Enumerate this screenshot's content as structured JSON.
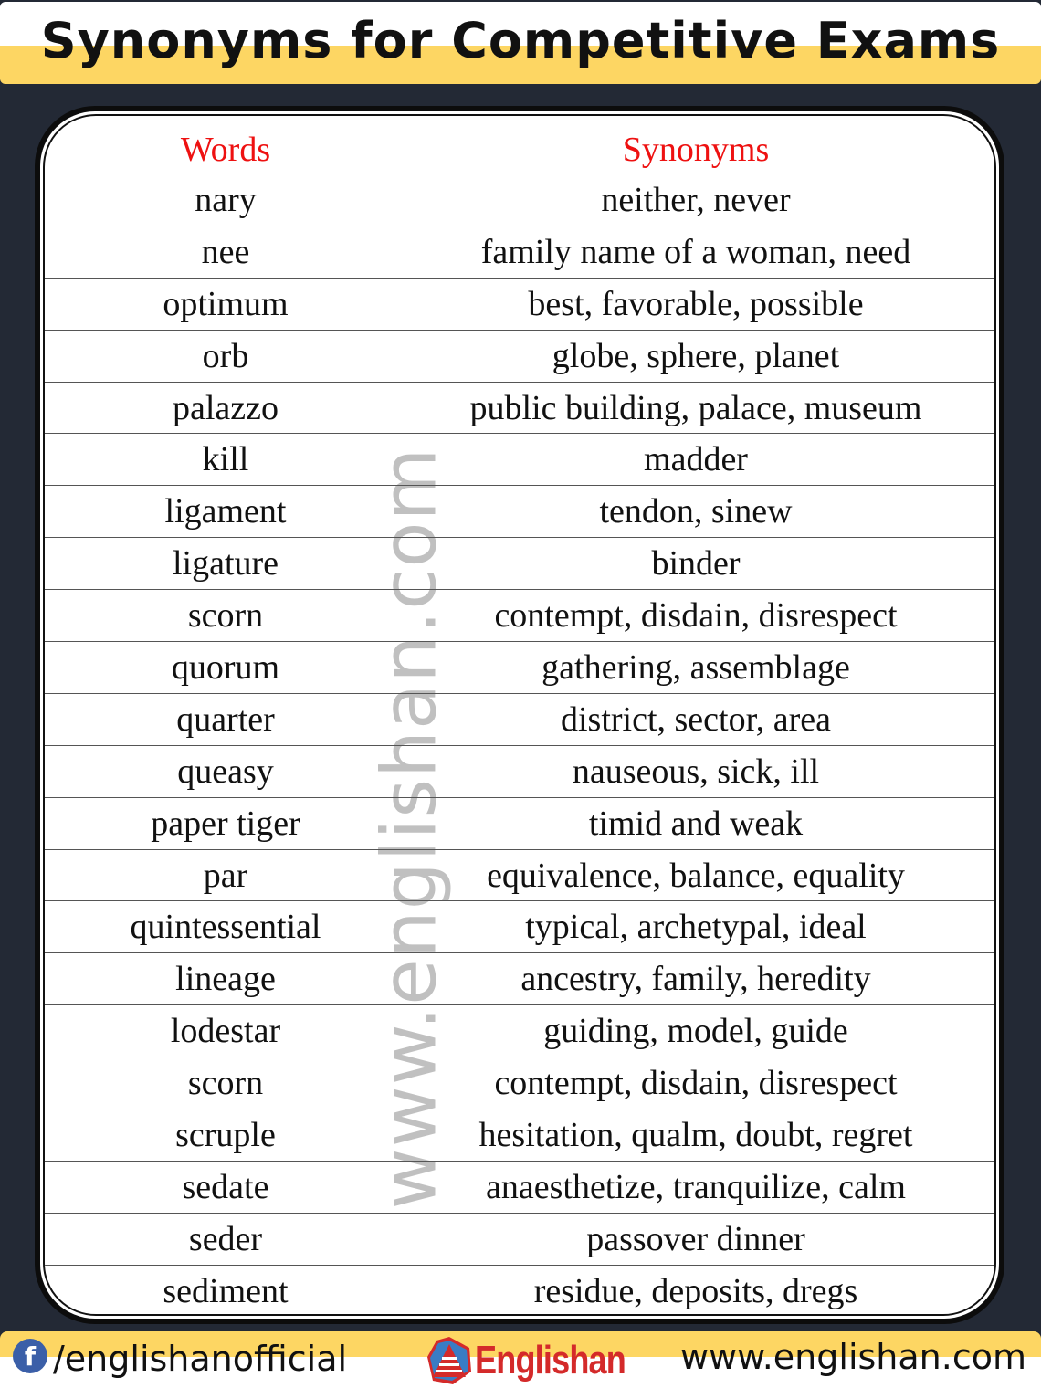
{
  "title": "Synonyms for Competitive Exams",
  "watermark": "www.englishan.com",
  "table": {
    "headers": {
      "word": "Words",
      "synonyms": "Synonyms"
    },
    "rows": [
      {
        "word": "nary",
        "synonyms": "neither, never"
      },
      {
        "word": "nee",
        "synonyms": "family name of a woman, need"
      },
      {
        "word": "optimum",
        "synonyms": "best, favorable, possible"
      },
      {
        "word": "orb",
        "synonyms": "globe, sphere, planet"
      },
      {
        "word": "palazzo",
        "synonyms": "public building, palace, museum"
      },
      {
        "word": "kill",
        "synonyms": "madder"
      },
      {
        "word": "ligament",
        "synonyms": "tendon, sinew"
      },
      {
        "word": "ligature",
        "synonyms": "binder"
      },
      {
        "word": "scorn",
        "synonyms": "contempt, disdain, disrespect"
      },
      {
        "word": "quorum",
        "synonyms": "gathering, assemblage"
      },
      {
        "word": "quarter",
        "synonyms": "district, sector, area"
      },
      {
        "word": "queasy",
        "synonyms": "nauseous, sick, ill"
      },
      {
        "word": "paper tiger",
        "synonyms": "timid and weak"
      },
      {
        "word": "par",
        "synonyms": "equivalence, balance, equality"
      },
      {
        "word": "quintessential",
        "synonyms": "typical, archetypal, ideal"
      },
      {
        "word": "lineage",
        "synonyms": "ancestry, family, heredity"
      },
      {
        "word": "lodestar",
        "synonyms": "guiding, model, guide"
      },
      {
        "word": "scorn",
        "synonyms": "contempt, disdain, disrespect"
      },
      {
        "word": "scruple",
        "synonyms": "hesitation, qualm, doubt, regret"
      },
      {
        "word": "sedate",
        "synonyms": "anaesthetize, tranquilize, calm"
      },
      {
        "word": "seder",
        "synonyms": "passover dinner"
      },
      {
        "word": "sediment",
        "synonyms": "residue, deposits, dregs"
      }
    ]
  },
  "footer": {
    "facebook_icon": "facebook-icon",
    "facebook_glyph": "f",
    "facebook_handle": "/englishanofficial",
    "logo_text": "Englishan",
    "website": "www.englishan.com"
  },
  "colors": {
    "background": "#232935",
    "accent_yellow": "#fdd663",
    "header_red": "#ee1111",
    "logo_red": "#d42a2a",
    "facebook_blue": "#3b5fa8"
  }
}
